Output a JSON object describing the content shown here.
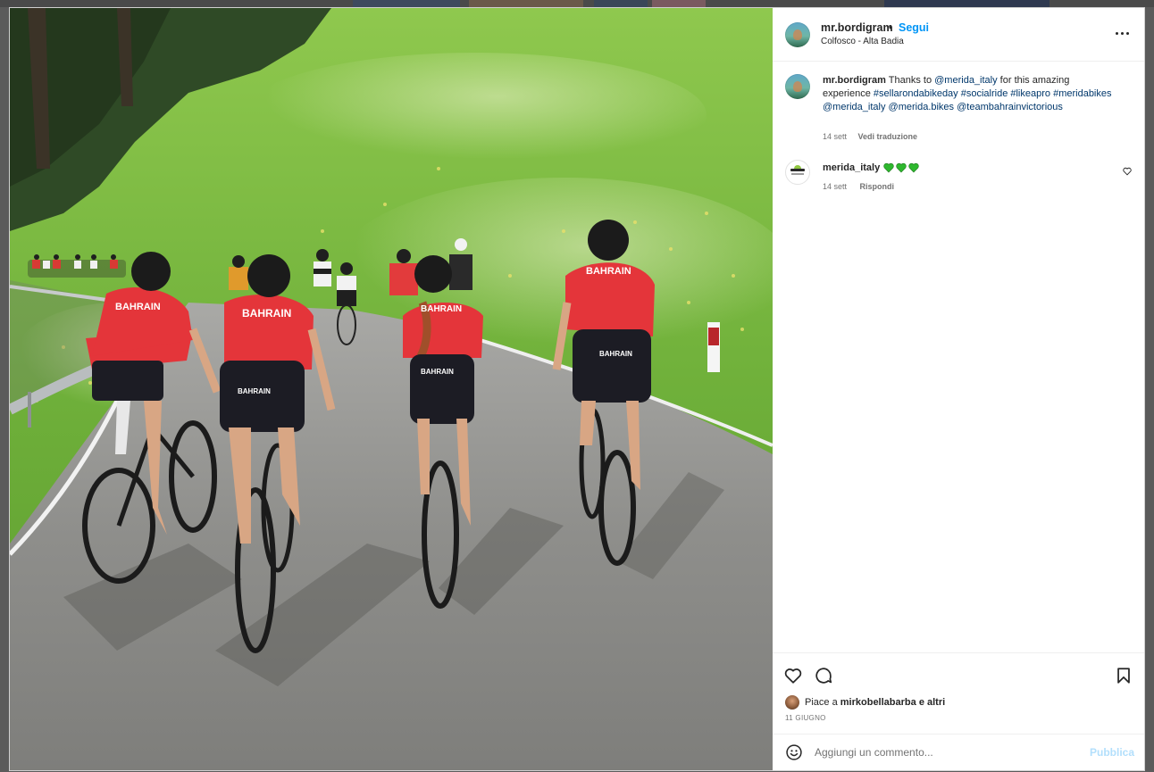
{
  "post": {
    "username": "mr.bordigram",
    "separator": "•",
    "follow_label": "Segui",
    "location": "Colfosco - Alta Badia",
    "more_icon": "more-horizontal-icon"
  },
  "caption": {
    "username": "mr.bordigram",
    "text_1": "Thanks to",
    "mention_1": "@merida_italy",
    "text_2": "for this amazing experience",
    "hashtags_1": "#sellarondabikeday #socialride #likeapro",
    "hashtags_2": "#meridabikes",
    "mention_2": "@merida_italy @merida.bikes",
    "mention_3": "@teambahrainvictorious",
    "time": "14 sett",
    "translate_label": "Vedi traduzione"
  },
  "comment": {
    "username": "merida_italy",
    "emoji": "green-heart-icon ×3",
    "time": "14 sett",
    "reply_label": "Rispondi",
    "like_icon": "heart-outline-icon"
  },
  "actions": {
    "like_icon": "heart-outline-icon",
    "comment_icon": "comment-bubble-icon",
    "save_icon": "bookmark-icon",
    "likes_prefix": "Piace a",
    "likes_user": "mirkobellabarba",
    "likes_suffix": "e altri",
    "date": "11 GIUGNO"
  },
  "comment_box": {
    "placeholder": "Aggiungi un commento...",
    "publish_label": "Pubblica"
  },
  "colors": {
    "link_blue": "#0095f6",
    "mention_blue": "#00376b",
    "muted": "#737373",
    "text": "#262626",
    "publish_disabled": "#b2dffc",
    "heart_green": "#2eb82e"
  }
}
